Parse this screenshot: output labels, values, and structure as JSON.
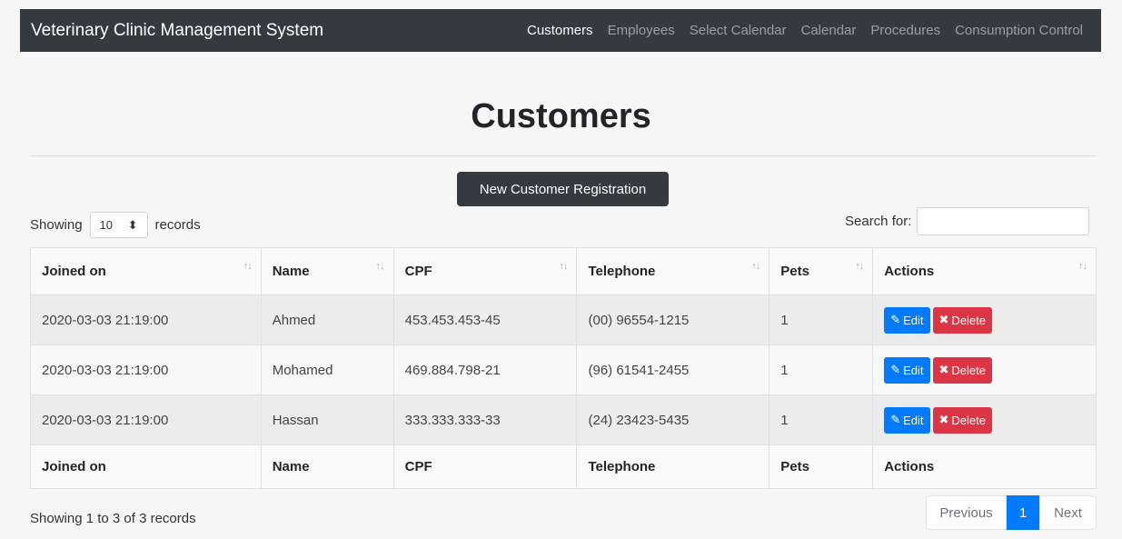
{
  "navbar": {
    "brand": "Veterinary Clinic Management System",
    "items": [
      {
        "label": "Customers",
        "active": true
      },
      {
        "label": "Employees",
        "active": false
      },
      {
        "label": "Select Calendar",
        "active": false
      },
      {
        "label": "Calendar",
        "active": false
      },
      {
        "label": "Procedures",
        "active": false
      },
      {
        "label": "Consumption Control",
        "active": false
      }
    ]
  },
  "page": {
    "title": "Customers",
    "new_button": "New Customer Registration"
  },
  "length": {
    "prefix": "Showing",
    "value": "10",
    "suffix": "records"
  },
  "search": {
    "label": "Search for:",
    "value": ""
  },
  "table": {
    "columns": [
      "Joined on",
      "Name",
      "CPF",
      "Telephone",
      "Pets",
      "Actions"
    ],
    "rows": [
      {
        "joined": "2020-03-03 21:19:00",
        "name": "Ahmed",
        "cpf": "453.453.453-45",
        "telephone": "(00) 96554-1215",
        "pets": "1"
      },
      {
        "joined": "2020-03-03 21:19:00",
        "name": "Mohamed",
        "cpf": "469.884.798-21",
        "telephone": "(96) 61541-2455",
        "pets": "1"
      },
      {
        "joined": "2020-03-03 21:19:00",
        "name": "Hassan",
        "cpf": "333.333.333-33",
        "telephone": "(24) 23423-5435",
        "pets": "1"
      }
    ],
    "edit_label": "Edit",
    "delete_label": "Delete"
  },
  "info": "Showing 1 to 3 of 3 records",
  "pagination": {
    "previous": "Previous",
    "current": "1",
    "next": "Next"
  },
  "colors": {
    "navbar": "#343a40",
    "primary": "#007bff",
    "danger": "#dc3545"
  },
  "icons": {
    "edit": "edit-icon",
    "delete": "delete-x-icon",
    "sort": "sort-arrows-icon",
    "select_caret": "updown-caret-icon"
  }
}
